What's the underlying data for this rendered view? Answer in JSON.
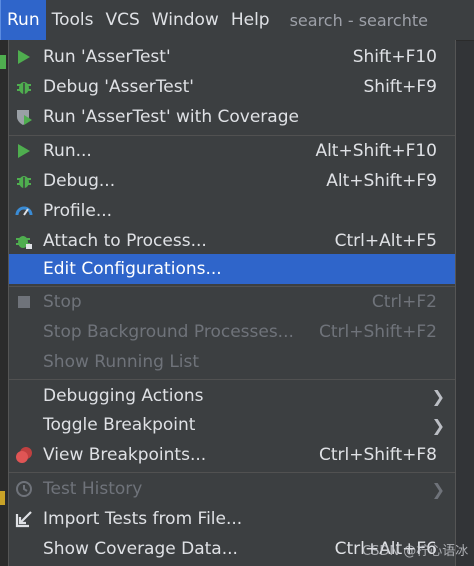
{
  "menubar": {
    "items": [
      "Run",
      "Tools",
      "VCS",
      "Window",
      "Help"
    ],
    "window_title": "search - searchte"
  },
  "menu": {
    "items": [
      {
        "label": "Run 'AsserTest'",
        "shortcut": "Shift+F10",
        "icon": "run-icon"
      },
      {
        "label": "Debug 'AsserTest'",
        "shortcut": "Shift+F9",
        "icon": "debug-icon"
      },
      {
        "label": "Run 'AsserTest' with Coverage",
        "shortcut": "",
        "icon": "coverage-icon"
      },
      {
        "label": "Run...",
        "shortcut": "Alt+Shift+F10",
        "icon": "run-icon"
      },
      {
        "label": "Debug...",
        "shortcut": "Alt+Shift+F9",
        "icon": "debug-icon"
      },
      {
        "label": "Profile...",
        "shortcut": "",
        "icon": "profile-icon"
      },
      {
        "label": "Attach to Process...",
        "shortcut": "Ctrl+Alt+F5",
        "icon": "attach-icon"
      },
      {
        "label": "Edit Configurations...",
        "shortcut": "",
        "icon": ""
      },
      {
        "label": "Stop",
        "shortcut": "Ctrl+F2",
        "icon": "stop-icon"
      },
      {
        "label": "Stop Background Processes...",
        "shortcut": "Ctrl+Shift+F2",
        "icon": ""
      },
      {
        "label": "Show Running List",
        "shortcut": "",
        "icon": ""
      },
      {
        "label": "Debugging Actions",
        "shortcut": "",
        "icon": "",
        "submenu": ">"
      },
      {
        "label": "Toggle Breakpoint",
        "shortcut": "",
        "icon": "",
        "submenu": ">"
      },
      {
        "label": "View Breakpoints...",
        "shortcut": "Ctrl+Shift+F8",
        "icon": "breakpoints-icon"
      },
      {
        "label": "Test History",
        "shortcut": "",
        "icon": "history-icon",
        "submenu": ">"
      },
      {
        "label": "Import Tests from File...",
        "shortcut": "",
        "icon": "import-icon"
      },
      {
        "label": "Show Coverage Data...",
        "shortcut": "Ctrl+Alt+F6",
        "icon": ""
      }
    ]
  },
  "watermark": "CSDN @柠心语冰",
  "colors": {
    "menu_bg": "#3c3f41",
    "selection": "#2f65ca",
    "run_green": "#4fae4f",
    "breakpoint_red": "#e05555",
    "profile_blue": "#3a8cd6"
  }
}
